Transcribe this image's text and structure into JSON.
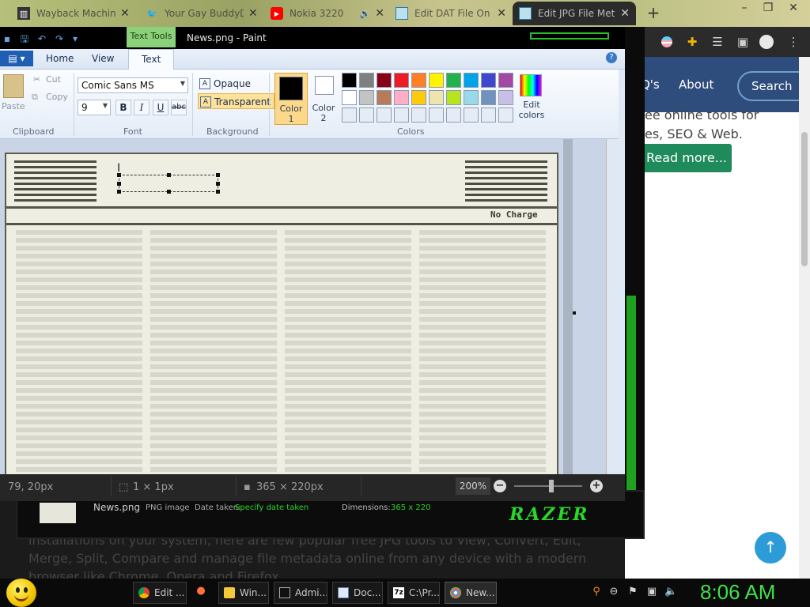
{
  "browser": {
    "tabs": [
      {
        "title": "Wayback Machine",
        "icon": "archive-icon"
      },
      {
        "title": "Your Gay BuddyD",
        "icon": "twitter-icon"
      },
      {
        "title": "Nokia 3220",
        "icon": "youtube-icon"
      },
      {
        "title": "Edit DAT File On",
        "icon": "page-icon"
      },
      {
        "title": "Edit JPG File Meta",
        "icon": "page-icon"
      }
    ],
    "new_tab": "+",
    "window_controls": {
      "minimize": "–",
      "restore": "❐",
      "close": "✕"
    }
  },
  "webpage": {
    "nav": {
      "faq": "Q's",
      "about": "About",
      "search": "Search"
    },
    "text_lines": [
      "ee online tools for",
      "es, SEO & Web."
    ],
    "read_more": "Read more...",
    "bottom_lines": [
      "installations on your system, here are few popular free JPG tools to View, Convert, Edit,",
      "Merge, Split, Compare and manage file metadata online from any device with a modern",
      "browser like Chrome, Opera and Firefox."
    ]
  },
  "overlay": {
    "filename": "News.png",
    "filetype": "PNG image",
    "date_label": "Date taken:",
    "date_value": "Specify date taken",
    "dimensions_label": "Dimensions:",
    "dimensions_value": "365 x 220",
    "logo": "RAZER"
  },
  "paint": {
    "context_tab": "Text Tools",
    "title": "News.png - Paint",
    "ribbon_tabs": [
      "Home",
      "View",
      "Text"
    ],
    "active_tab": "Text",
    "clipboard": {
      "paste": "Paste",
      "cut": "Cut",
      "copy": "Copy",
      "label": "Clipboard"
    },
    "font": {
      "family": "Comic Sans MS",
      "size": "9",
      "bold": "B",
      "italic": "I",
      "underline": "U",
      "strike": "abc",
      "label": "Font"
    },
    "background": {
      "opaque": "Opaque",
      "transparent": "Transparent",
      "label": "Background"
    },
    "colors": {
      "color1_label": "Color 1",
      "color2_label": "Color 2",
      "label": "Colors",
      "edit_label": "Edit colors",
      "color1": "#000000",
      "color2": "#ffffff",
      "palette": [
        "#000000",
        "#7f7f7f",
        "#880015",
        "#ed1c24",
        "#ff7f27",
        "#fff200",
        "#22b14c",
        "#00a2e8",
        "#3f48cc",
        "#a349a4",
        "#ffffff",
        "#c3c3c3",
        "#b97a57",
        "#ffaec9",
        "#ffc90e",
        "#efe4b0",
        "#b5e61d",
        "#99d9ea",
        "#7092be",
        "#c8bfe7",
        "#e6ecf5",
        "#e6ecf5",
        "#e6ecf5",
        "#e6ecf5",
        "#e6ecf5",
        "#e6ecf5",
        "#e6ecf5",
        "#e6ecf5",
        "#e6ecf5",
        "#e6ecf5"
      ]
    },
    "image_text": "No Charge",
    "status": {
      "cursor": "79, 20px",
      "selection": "1 × 1px",
      "image_size": "365 × 220px",
      "zoom": "200%"
    }
  },
  "taskbar": {
    "buttons": [
      {
        "label": "Edit ...",
        "icon": "chrome-icon"
      },
      {
        "label": "Win...",
        "icon": "folder-icon"
      },
      {
        "label": "Admi...",
        "icon": "cmd-icon"
      },
      {
        "label": "Doc...",
        "icon": "document-icon"
      },
      {
        "label": "C:\\Pr...",
        "icon": "7zip-icon"
      },
      {
        "label": "New...",
        "icon": "paint-icon"
      }
    ],
    "time": "8:06 AM"
  }
}
